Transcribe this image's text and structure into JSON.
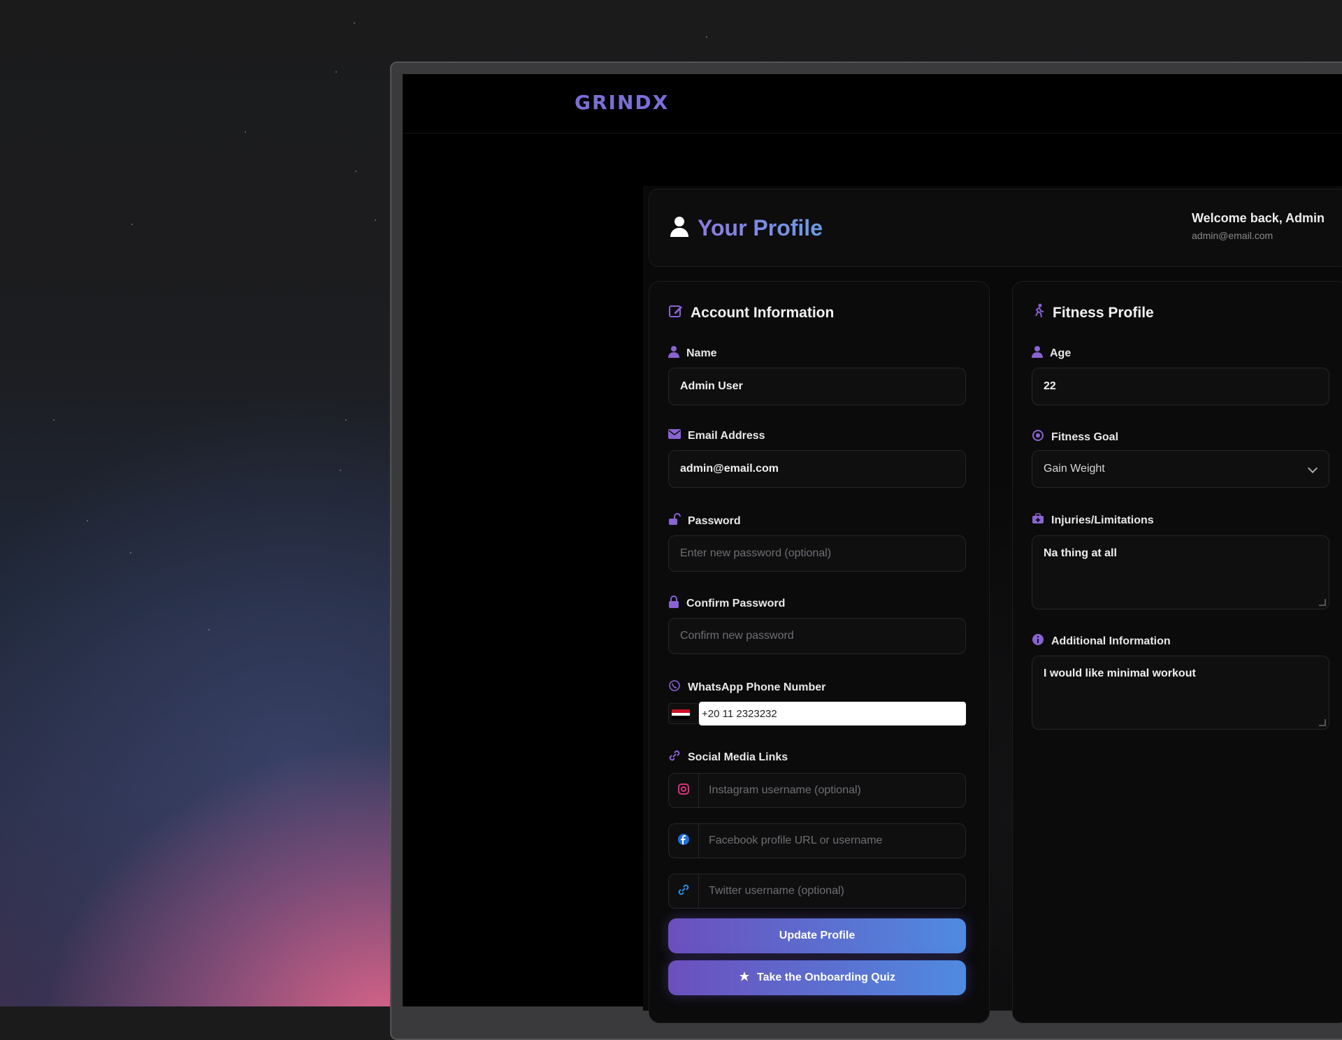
{
  "app": {
    "brand": "GRINDX"
  },
  "header": {
    "title": "Your Profile",
    "welcome": "Welcome back, Admin",
    "email": "admin@email.com"
  },
  "account": {
    "title": "Account Information",
    "name_label": "Name",
    "name_value": "Admin User",
    "email_label": "Email Address",
    "email_value": "admin@email.com",
    "password_label": "Password",
    "password_placeholder": "Enter new password (optional)",
    "confirm_label": "Confirm Password",
    "confirm_placeholder": "Confirm new password",
    "whatsapp_label": "WhatsApp Phone Number",
    "whatsapp_value": "+20 11 2323232",
    "social_label": "Social Media Links",
    "instagram_placeholder": "Instagram username (optional)",
    "facebook_placeholder": "Facebook profile URL or username",
    "twitter_placeholder": "Twitter username (optional)",
    "update_button": "Update Profile",
    "quiz_button": "Take the Onboarding Quiz"
  },
  "fitness": {
    "title": "Fitness Profile",
    "age_label": "Age",
    "age_value": "22",
    "goal_label": "Fitness Goal",
    "goal_value": "Gain Weight",
    "injuries_label": "Injuries/Limitations",
    "injuries_value": "Na thing at all",
    "additional_label": "Additional Information",
    "additional_value": "I would like minimal workout"
  },
  "colors": {
    "accent": "#7a5cd6",
    "accent2": "#4f8be0",
    "background": "#000000"
  },
  "icons": [
    "user-icon",
    "edit-icon",
    "mail-icon",
    "unlock-icon",
    "lock-icon",
    "whatsapp-icon",
    "link-icon",
    "instagram-icon",
    "facebook-icon",
    "twitter-link-icon",
    "star-icon",
    "running-icon",
    "target-icon",
    "medkit-icon",
    "info-icon",
    "chevron-down-icon",
    "egypt-flag-icon"
  ]
}
